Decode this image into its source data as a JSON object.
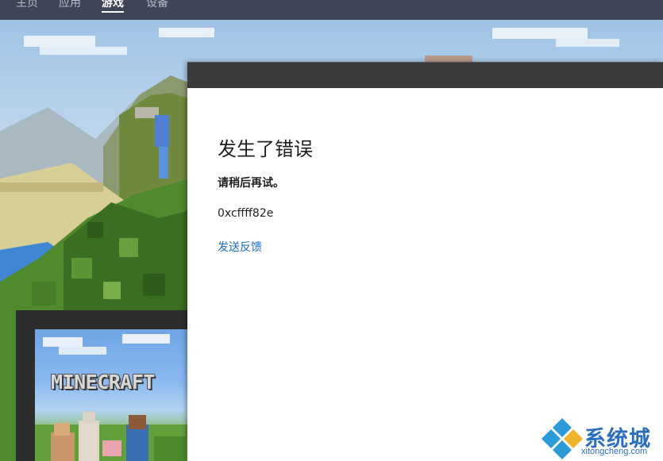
{
  "nav": {
    "items": [
      {
        "label": "主页"
      },
      {
        "label": "应用"
      },
      {
        "label": "游戏",
        "active": true
      },
      {
        "label": "设备"
      }
    ]
  },
  "card": {
    "logo_text": "MINECRAFT"
  },
  "dialog": {
    "heading": "发生了错误",
    "message": "请稍后再试。",
    "error_code": "0xcffff82e",
    "feedback_link": "发送反馈"
  },
  "watermark": {
    "brand": "系统城",
    "url": "xitongcheng.com"
  },
  "colors": {
    "nav_bg": "#3e4557",
    "dialog_titlebar": "#3a3a3a",
    "link": "#1a6fc7",
    "watermark": "#2a6fbf"
  }
}
